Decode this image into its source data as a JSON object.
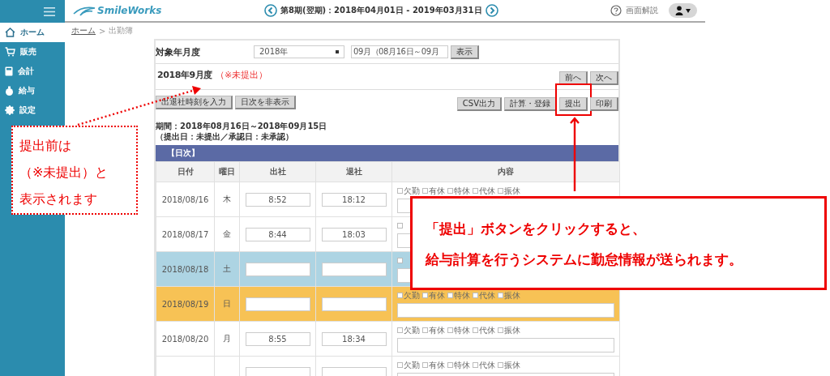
{
  "sidebar": {
    "items": [
      {
        "label": "ホーム",
        "selected": true
      },
      {
        "label": "販売",
        "selected": false
      },
      {
        "label": "会計",
        "selected": false
      },
      {
        "label": "給与",
        "selected": false
      },
      {
        "label": "設定",
        "selected": false
      }
    ]
  },
  "header": {
    "logo": "SmileWorks",
    "period": "第8期(翌期)：2018年04月01日 - 2019年03月31日",
    "help": "画面解説"
  },
  "breadcrumb": {
    "items": [
      "ホーム",
      "出勤簿"
    ],
    "separator": ">"
  },
  "filter": {
    "label": "対象年月度",
    "year": "2018年",
    "month": "09月（08月16日～09月",
    "button": "表示"
  },
  "title": {
    "month": "2018年9月度",
    "status": "（※未提出）"
  },
  "nav_buttons": [
    "前へ",
    "次へ"
  ],
  "left_actions": [
    "出退社時刻を入力",
    "日次を非表示"
  ],
  "right_actions": [
    {
      "label": "CSV出力",
      "highlighted": false
    },
    {
      "label": "計算・登録",
      "highlighted": false
    },
    {
      "label": "提出",
      "highlighted": true
    },
    {
      "label": "印刷",
      "highlighted": false
    }
  ],
  "period": "期間：2018年08月16日～2018年09月15日",
  "dates_status": "（提出日：未提出／承認日：未承認）",
  "table": {
    "section": "【日次】",
    "columns": [
      "日付",
      "曜日",
      "出社",
      "退社",
      "内容"
    ],
    "rows": [
      {
        "date": "2018/08/16",
        "weekday": "木",
        "kind": "weekday",
        "in": "8:52",
        "out": "18:12",
        "leave": [
          {
            "label": "欠勤",
            "checked": false
          },
          {
            "label": "有休",
            "checked": false
          },
          {
            "label": "特休",
            "checked": false
          },
          {
            "label": "代休",
            "checked": false
          },
          {
            "label": "振休",
            "checked": false
          }
        ]
      },
      {
        "date": "2018/08/17",
        "weekday": "金",
        "kind": "weekday",
        "in": "8:44",
        "out": "18:03",
        "leave": [
          {
            "checked": false
          }
        ]
      },
      {
        "date": "2018/08/18",
        "weekday": "土",
        "kind": "saturday",
        "in": "",
        "out": "",
        "leave": [
          {
            "checked": false
          }
        ]
      },
      {
        "date": "2018/08/19",
        "weekday": "日",
        "kind": "sunday",
        "in": "",
        "out": "",
        "leave": [
          {
            "label": "欠勤",
            "checked": false
          },
          {
            "label": "有休",
            "checked": false
          },
          {
            "label": "特休",
            "checked": false
          },
          {
            "label": "代休",
            "checked": false
          },
          {
            "label": "振休",
            "checked": false
          }
        ]
      },
      {
        "date": "2018/08/20",
        "weekday": "月",
        "kind": "weekday",
        "in": "8:55",
        "out": "18:34",
        "leave": [
          {
            "label": "欠勤",
            "checked": false
          },
          {
            "label": "有休",
            "checked": false
          },
          {
            "label": "特休",
            "checked": false
          },
          {
            "label": "代休",
            "checked": false
          },
          {
            "label": "振休",
            "checked": false
          }
        ]
      },
      {
        "kind": "weekday",
        "leave": [
          {
            "label": "欠勤",
            "checked": false
          },
          {
            "label": "有休",
            "checked": false
          },
          {
            "label": "特休",
            "checked": false
          },
          {
            "label": "代休",
            "checked": false
          },
          {
            "label": "振休",
            "checked": false
          }
        ]
      }
    ]
  },
  "notes": [
    {
      "kind": "dotted",
      "lines": [
        "提出前は",
        "（※未提出）と",
        "表示されます"
      ]
    },
    {
      "kind": "solid",
      "lines": [
        "「提出」ボタンをクリックすると、",
        "給与計算を行うシステムに勤怠情報が送られます。"
      ]
    }
  ]
}
